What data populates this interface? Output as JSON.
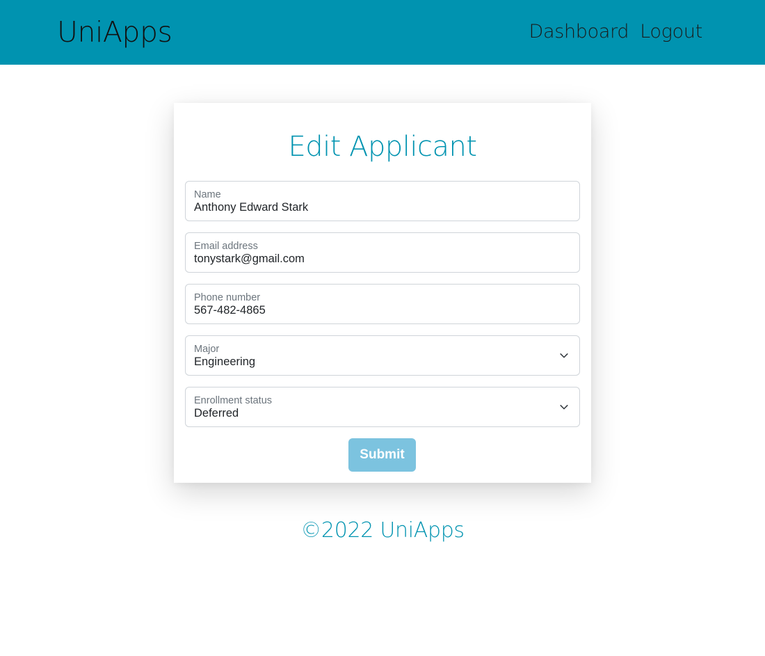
{
  "header": {
    "brand": "UniApps",
    "nav": [
      "Dashboard",
      "Logout"
    ]
  },
  "form": {
    "title": "Edit Applicant",
    "fields": [
      {
        "label": "Name",
        "value": "Anthony Edward Stark"
      },
      {
        "label": "Email address",
        "value": "tonystark@gmail.com"
      },
      {
        "label": "Phone number",
        "value": "567-482-4865"
      }
    ],
    "selects": [
      {
        "label": "Major",
        "value": "Engineering"
      },
      {
        "label": "Enrollment status",
        "value": "Deferred"
      }
    ],
    "submit_label": "Submit"
  },
  "footer": {
    "text": "©2022 UniApps"
  },
  "colors": {
    "primary": "#0093b0",
    "button": "#7cc3df",
    "field_border": "#cfd4d9",
    "label": "#6c757d"
  },
  "icons": {
    "select_arrow": "chevron-down-icon"
  }
}
